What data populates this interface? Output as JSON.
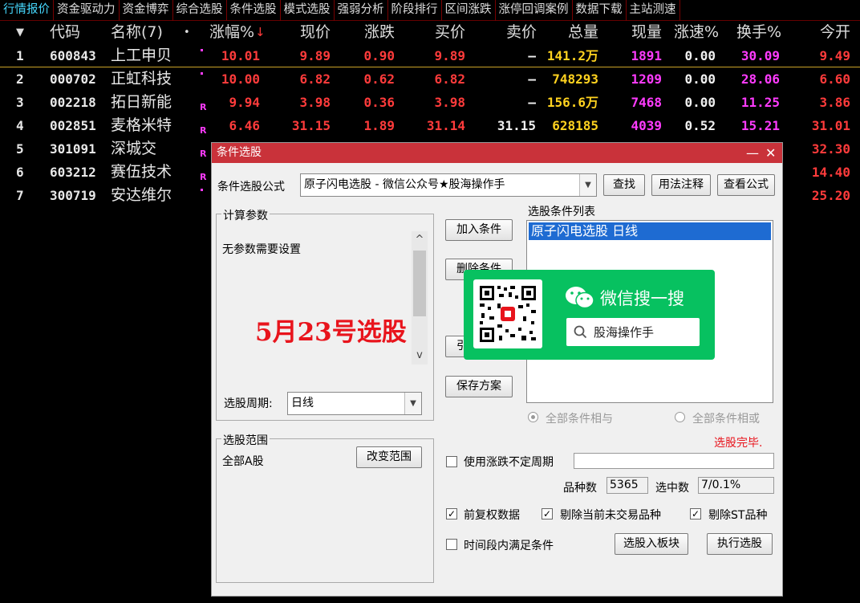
{
  "menu_tabs": [
    "行情报价",
    "资金驱动力",
    "资金博弈",
    "综合选股",
    "条件选股",
    "模式选股",
    "强弱分析",
    "阶段排行",
    "区间涨跌",
    "涨停回调案例",
    "数据下载",
    "主站测速"
  ],
  "table": {
    "headers": {
      "sort_arrow": "▼",
      "code": "代码",
      "name": "名称(7)",
      "name_dot": "•",
      "change_pct": "涨幅%",
      "change_pct_arrow": "↓",
      "price": "现价",
      "change": "涨跌",
      "bid": "买价",
      "ask": "卖价",
      "volume": "总量",
      "cur_volume": "现量",
      "speed": "涨速%",
      "turnover": "换手%",
      "open": "今开"
    },
    "rows": [
      {
        "idx": "1",
        "code": "600843",
        "name": "上工申贝",
        "flag": "",
        "change_pct": "10.01",
        "price": "9.89",
        "change": "0.90",
        "bid": "9.89",
        "ask": "—",
        "volume": "141.2万",
        "cur_volume": "1891",
        "speed": "0.00",
        "turnover": "30.09",
        "open": "9.49"
      },
      {
        "idx": "2",
        "code": "000702",
        "name": "正虹科技",
        "flag": "",
        "change_pct": "10.00",
        "price": "6.82",
        "change": "0.62",
        "bid": "6.82",
        "ask": "—",
        "volume": "748293",
        "cur_volume": "1209",
        "speed": "0.00",
        "turnover": "28.06",
        "open": "6.60"
      },
      {
        "idx": "3",
        "code": "002218",
        "name": "拓日新能",
        "flag": "R",
        "change_pct": "9.94",
        "price": "3.98",
        "change": "0.36",
        "bid": "3.98",
        "ask": "—",
        "volume": "156.6万",
        "cur_volume": "7468",
        "speed": "0.00",
        "turnover": "11.25",
        "open": "3.86"
      },
      {
        "idx": "4",
        "code": "002851",
        "name": "麦格米特",
        "flag": "R",
        "change_pct": "6.46",
        "price": "31.15",
        "change": "1.89",
        "bid": "31.14",
        "ask": "31.15",
        "volume": "628185",
        "cur_volume": "4039",
        "speed": "0.52",
        "turnover": "15.21",
        "open": "31.01"
      },
      {
        "idx": "5",
        "code": "301091",
        "name": "深城交",
        "flag": "R",
        "open": "32.30"
      },
      {
        "idx": "6",
        "code": "603212",
        "name": "赛伍技术",
        "flag": "R",
        "open": "14.40"
      },
      {
        "idx": "7",
        "code": "300719",
        "name": "安达维尔",
        "flag": "",
        "open": "25.20"
      }
    ]
  },
  "dialog": {
    "title": "条件选股",
    "min_glyph": "—",
    "close_glyph": "✕",
    "formula_label": "条件选股公式",
    "formula_value": "原子闪电选股  -  微信公众号★股海操作手",
    "find_btn": "查找",
    "usage_btn": "用法注释",
    "view_formula_btn": "查看公式",
    "params_group": "计算参数",
    "no_params": "无参数需要设置",
    "overlay_text": "5月23号选股",
    "period_label": "选股周期:",
    "period_value": "日线",
    "add_cond_btn": "加入条件",
    "del_cond_btn": "删除条件",
    "import_btn": "引入方案",
    "save_btn": "保存方案",
    "cond_list_label": "选股条件列表",
    "cond_items": [
      "原子闪电选股  日线"
    ],
    "radio_and": "全部条件相与",
    "radio_or": "全部条件相或",
    "status": "选股完毕.",
    "range_group": "选股范围",
    "range_value": "全部A股",
    "change_range_btn": "改变范围",
    "use_period_label": "使用涨跌不定周期",
    "stock_count_label": "品种数",
    "stock_count": "5365",
    "selected_label": "选中数",
    "selected": "7/0.1%",
    "adj_label": "前复权数据",
    "exclude_notrade_label": "剔除当前未交易品种",
    "exclude_st_label": "剔除ST品种",
    "time_range_label": "时间段内满足条件",
    "to_block_btn": "选股入板块",
    "execute_btn": "执行选股",
    "check_mark": "✓",
    "scroll_up": "^",
    "scroll_down": "v",
    "combo_arrow": "▼"
  },
  "wechat_banner": {
    "title": "微信搜一搜",
    "search_text": "股海操作手",
    "colors": {
      "bg": "#07c160",
      "panel": "#ffffff"
    }
  },
  "colors": {
    "up": "#ff3b3b",
    "volume": "#ffd21f",
    "cur_volume": "#ff3bff",
    "active_tab": "#46d9ff",
    "dialog_title": "#c9323a"
  }
}
